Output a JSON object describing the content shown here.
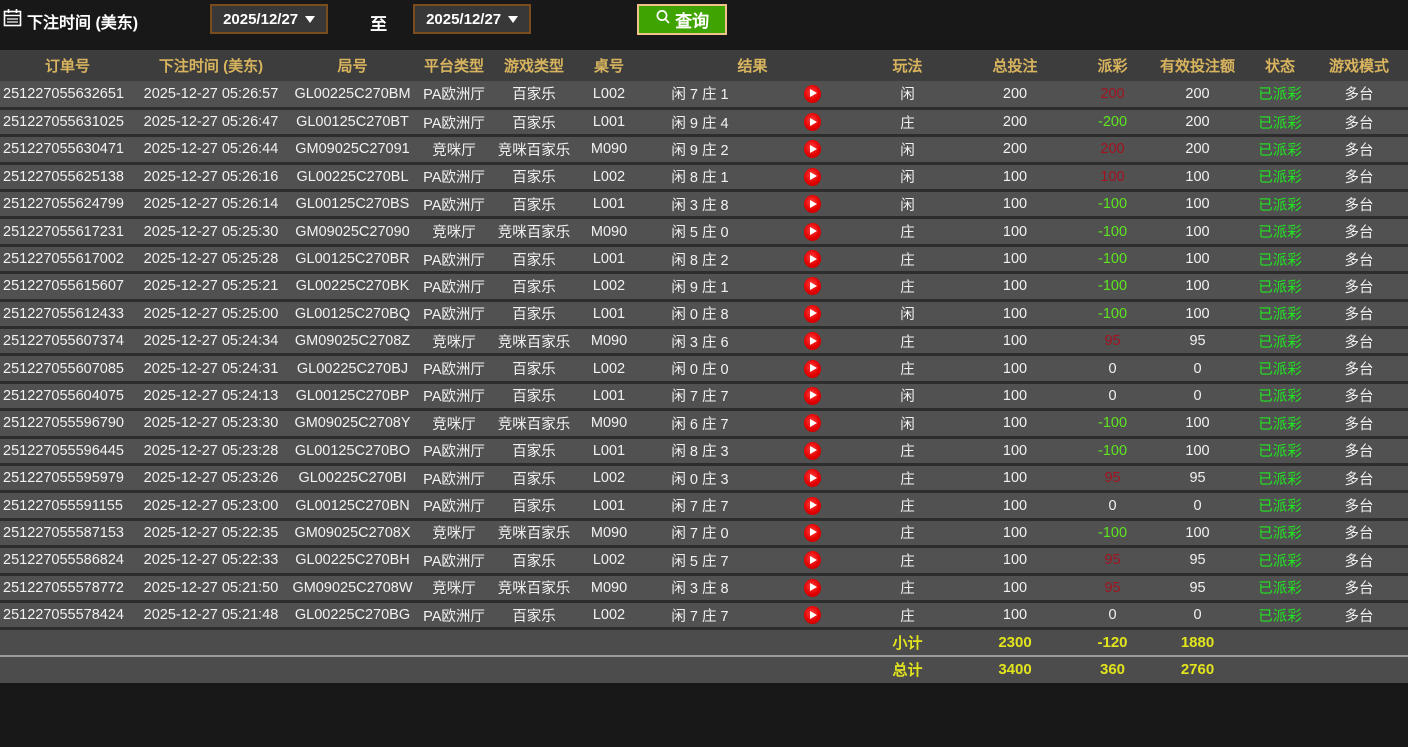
{
  "filter_bar": {
    "label": "下注时间 (美东)",
    "date_from": "2025/12/27",
    "to_label": "至",
    "date_to": "2025/12/27",
    "query_label": "查询"
  },
  "icons": {
    "calendar": "calendar-icon",
    "search": "search-icon",
    "dropdown_arrow": "chevron-down-icon",
    "play": "play-video-icon"
  },
  "colors": {
    "background": "#181818",
    "header_bg": "#3d3d3d",
    "header_text_gold": "#d8b45e",
    "row_bg": "#515151",
    "row_divider": "#2d2d2d",
    "data_text": "#f2f2f2",
    "payout_win_red": "#a31220",
    "payout_loss_green": "#5ce61e",
    "status_green": "#22e522",
    "totals_yellow": "#e2e41c",
    "query_button_green": "#3fa302",
    "query_button_border": "#eec288",
    "date_border_brown": "#7a4d1e",
    "play_icon_red": "#e30000"
  },
  "table": {
    "headers": [
      "订单号",
      "下注时间 (美东)",
      "局号",
      "平台类型",
      "游戏类型",
      "桌号",
      "结果",
      "玩法",
      "总投注",
      "派彩",
      "有效投注额",
      "状态",
      "游戏模式"
    ],
    "rows": [
      {
        "order_id": "251227055632651",
        "bet_time": "2025-12-27 05:26:57",
        "round_id": "GL00225C270BM",
        "platform": "PA欧洲厅",
        "game_type": "百家乐",
        "table_no": "L002",
        "result": "闲 7 庄 1",
        "play": "闲",
        "total_bet": "200",
        "payout": "200",
        "valid_bet": "200",
        "status": "已派彩",
        "mode": "多台"
      },
      {
        "order_id": "251227055631025",
        "bet_time": "2025-12-27 05:26:47",
        "round_id": "GL00125C270BT",
        "platform": "PA欧洲厅",
        "game_type": "百家乐",
        "table_no": "L001",
        "result": "闲 9 庄 4",
        "play": "庄",
        "total_bet": "200",
        "payout": "-200",
        "valid_bet": "200",
        "status": "已派彩",
        "mode": "多台"
      },
      {
        "order_id": "251227055630471",
        "bet_time": "2025-12-27 05:26:44",
        "round_id": "GM09025C27091",
        "platform": "竞咪厅",
        "game_type": "竞咪百家乐",
        "table_no": "M090",
        "result": "闲 9 庄 2",
        "play": "闲",
        "total_bet": "200",
        "payout": "200",
        "valid_bet": "200",
        "status": "已派彩",
        "mode": "多台"
      },
      {
        "order_id": "251227055625138",
        "bet_time": "2025-12-27 05:26:16",
        "round_id": "GL00225C270BL",
        "platform": "PA欧洲厅",
        "game_type": "百家乐",
        "table_no": "L002",
        "result": "闲 8 庄 1",
        "play": "闲",
        "total_bet": "100",
        "payout": "100",
        "valid_bet": "100",
        "status": "已派彩",
        "mode": "多台"
      },
      {
        "order_id": "251227055624799",
        "bet_time": "2025-12-27 05:26:14",
        "round_id": "GL00125C270BS",
        "platform": "PA欧洲厅",
        "game_type": "百家乐",
        "table_no": "L001",
        "result": "闲 3 庄 8",
        "play": "闲",
        "total_bet": "100",
        "payout": "-100",
        "valid_bet": "100",
        "status": "已派彩",
        "mode": "多台"
      },
      {
        "order_id": "251227055617231",
        "bet_time": "2025-12-27 05:25:30",
        "round_id": "GM09025C27090",
        "platform": "竞咪厅",
        "game_type": "竞咪百家乐",
        "table_no": "M090",
        "result": "闲 5 庄 0",
        "play": "庄",
        "total_bet": "100",
        "payout": "-100",
        "valid_bet": "100",
        "status": "已派彩",
        "mode": "多台"
      },
      {
        "order_id": "251227055617002",
        "bet_time": "2025-12-27 05:25:28",
        "round_id": "GL00125C270BR",
        "platform": "PA欧洲厅",
        "game_type": "百家乐",
        "table_no": "L001",
        "result": "闲 8 庄 2",
        "play": "庄",
        "total_bet": "100",
        "payout": "-100",
        "valid_bet": "100",
        "status": "已派彩",
        "mode": "多台"
      },
      {
        "order_id": "251227055615607",
        "bet_time": "2025-12-27 05:25:21",
        "round_id": "GL00225C270BK",
        "platform": "PA欧洲厅",
        "game_type": "百家乐",
        "table_no": "L002",
        "result": "闲 9 庄 1",
        "play": "庄",
        "total_bet": "100",
        "payout": "-100",
        "valid_bet": "100",
        "status": "已派彩",
        "mode": "多台"
      },
      {
        "order_id": "251227055612433",
        "bet_time": "2025-12-27 05:25:00",
        "round_id": "GL00125C270BQ",
        "platform": "PA欧洲厅",
        "game_type": "百家乐",
        "table_no": "L001",
        "result": "闲 0 庄 8",
        "play": "闲",
        "total_bet": "100",
        "payout": "-100",
        "valid_bet": "100",
        "status": "已派彩",
        "mode": "多台"
      },
      {
        "order_id": "251227055607374",
        "bet_time": "2025-12-27 05:24:34",
        "round_id": "GM09025C2708Z",
        "platform": "竞咪厅",
        "game_type": "竞咪百家乐",
        "table_no": "M090",
        "result": "闲 3 庄 6",
        "play": "庄",
        "total_bet": "100",
        "payout": "95",
        "valid_bet": "95",
        "status": "已派彩",
        "mode": "多台"
      },
      {
        "order_id": "251227055607085",
        "bet_time": "2025-12-27 05:24:31",
        "round_id": "GL00225C270BJ",
        "platform": "PA欧洲厅",
        "game_type": "百家乐",
        "table_no": "L002",
        "result": "闲 0 庄 0",
        "play": "庄",
        "total_bet": "100",
        "payout": "0",
        "valid_bet": "0",
        "status": "已派彩",
        "mode": "多台"
      },
      {
        "order_id": "251227055604075",
        "bet_time": "2025-12-27 05:24:13",
        "round_id": "GL00125C270BP",
        "platform": "PA欧洲厅",
        "game_type": "百家乐",
        "table_no": "L001",
        "result": "闲 7 庄 7",
        "play": "闲",
        "total_bet": "100",
        "payout": "0",
        "valid_bet": "0",
        "status": "已派彩",
        "mode": "多台"
      },
      {
        "order_id": "251227055596790",
        "bet_time": "2025-12-27 05:23:30",
        "round_id": "GM09025C2708Y",
        "platform": "竞咪厅",
        "game_type": "竞咪百家乐",
        "table_no": "M090",
        "result": "闲 6 庄 7",
        "play": "闲",
        "total_bet": "100",
        "payout": "-100",
        "valid_bet": "100",
        "status": "已派彩",
        "mode": "多台"
      },
      {
        "order_id": "251227055596445",
        "bet_time": "2025-12-27 05:23:28",
        "round_id": "GL00125C270BO",
        "platform": "PA欧洲厅",
        "game_type": "百家乐",
        "table_no": "L001",
        "result": "闲 8 庄 3",
        "play": "庄",
        "total_bet": "100",
        "payout": "-100",
        "valid_bet": "100",
        "status": "已派彩",
        "mode": "多台"
      },
      {
        "order_id": "251227055595979",
        "bet_time": "2025-12-27 05:23:26",
        "round_id": "GL00225C270BI",
        "platform": "PA欧洲厅",
        "game_type": "百家乐",
        "table_no": "L002",
        "result": "闲 0 庄 3",
        "play": "庄",
        "total_bet": "100",
        "payout": "95",
        "valid_bet": "95",
        "status": "已派彩",
        "mode": "多台"
      },
      {
        "order_id": "251227055591155",
        "bet_time": "2025-12-27 05:23:00",
        "round_id": "GL00125C270BN",
        "platform": "PA欧洲厅",
        "game_type": "百家乐",
        "table_no": "L001",
        "result": "闲 7 庄 7",
        "play": "庄",
        "total_bet": "100",
        "payout": "0",
        "valid_bet": "0",
        "status": "已派彩",
        "mode": "多台"
      },
      {
        "order_id": "251227055587153",
        "bet_time": "2025-12-27 05:22:35",
        "round_id": "GM09025C2708X",
        "platform": "竞咪厅",
        "game_type": "竞咪百家乐",
        "table_no": "M090",
        "result": "闲 7 庄 0",
        "play": "庄",
        "total_bet": "100",
        "payout": "-100",
        "valid_bet": "100",
        "status": "已派彩",
        "mode": "多台"
      },
      {
        "order_id": "251227055586824",
        "bet_time": "2025-12-27 05:22:33",
        "round_id": "GL00225C270BH",
        "platform": "PA欧洲厅",
        "game_type": "百家乐",
        "table_no": "L002",
        "result": "闲 5 庄 7",
        "play": "庄",
        "total_bet": "100",
        "payout": "95",
        "valid_bet": "95",
        "status": "已派彩",
        "mode": "多台"
      },
      {
        "order_id": "251227055578772",
        "bet_time": "2025-12-27 05:21:50",
        "round_id": "GM09025C2708W",
        "platform": "竞咪厅",
        "game_type": "竞咪百家乐",
        "table_no": "M090",
        "result": "闲 3 庄 8",
        "play": "庄",
        "total_bet": "100",
        "payout": "95",
        "valid_bet": "95",
        "status": "已派彩",
        "mode": "多台"
      },
      {
        "order_id": "251227055578424",
        "bet_time": "2025-12-27 05:21:48",
        "round_id": "GL00225C270BG",
        "platform": "PA欧洲厅",
        "game_type": "百家乐",
        "table_no": "L002",
        "result": "闲 7 庄 7",
        "play": "庄",
        "total_bet": "100",
        "payout": "0",
        "valid_bet": "0",
        "status": "已派彩",
        "mode": "多台"
      }
    ],
    "subtotal": {
      "label": "小计",
      "total_bet": "2300",
      "payout": "-120",
      "valid_bet": "1880"
    },
    "grand_total": {
      "label": "总计",
      "total_bet": "3400",
      "payout": "360",
      "valid_bet": "2760"
    }
  }
}
